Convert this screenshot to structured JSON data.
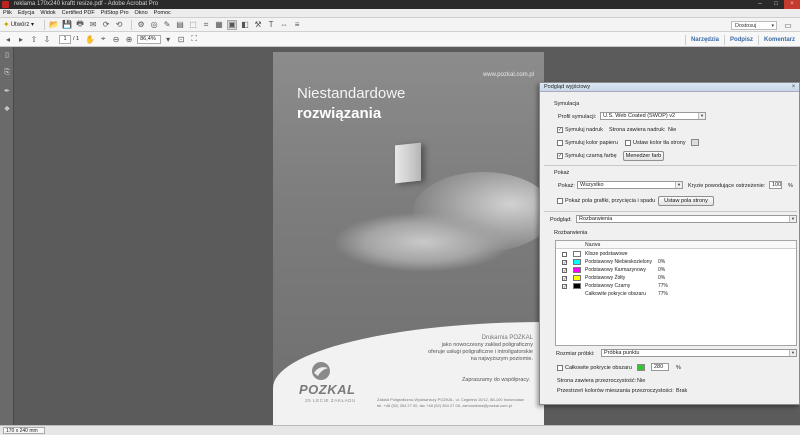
{
  "window": {
    "title": "reklama 170x240 kraftt resize.pdf - Adobe Acrobat Pro",
    "controls": [
      "–",
      "□",
      "×"
    ]
  },
  "menu": {
    "items": [
      "Plik",
      "Edycja",
      "Widok",
      "Certified PDF",
      "PitStop Pro",
      "Okno",
      "Pomoc"
    ]
  },
  "toolbar": {
    "create_label": "Utwórz",
    "workspace": "Dostosuj"
  },
  "navigation": {
    "page_current": "1",
    "page_total": "/ 1",
    "zoom": "86,4%",
    "links": [
      "Narzędzia",
      "Podpisz",
      "Komentarz"
    ]
  },
  "document": {
    "url": "www.pozkal.com.pl",
    "headline_1": "Niestandardowe",
    "headline_2": "rozwiązania",
    "drukarnia": "Drukarnia POZKAL",
    "body_lines": [
      "jako nowoczesny zakład poligraficzny",
      "oferuje usługi poligraficzne i introligatorskie",
      "na najwyższym poziomie."
    ],
    "zapraszamy": "Zapraszamy do współpracy.",
    "logo_word": "POZKAL",
    "logo_sub": "25 LECIE ZAKŁADU",
    "footer_lines": [
      "Zakład Poligraficzno-Wydawniczy POZKAL, ul. Cegielna 10/12, 88-100 Inowrocław",
      "tel. +48 (52) 354 27 00, fax +48 (52) 354 27 05, zamowienia@pozkal.com.pl"
    ]
  },
  "status": {
    "size": "170 x 240 mm"
  },
  "dialog": {
    "title": "Podgląd wyjściowy",
    "close": "×",
    "symulacja": {
      "section": "Symulacja",
      "profile_label": "Profil symulacji:",
      "profile_value": "U.S. Web Coated (SWOP) v2",
      "simulate_overprint": "Symuluj nadruk",
      "page_has_overprint": "Strona zawiera nadruk:",
      "page_has_overprint_value": "Nie",
      "simulate_paper_color": "Symuluj kolor papieru",
      "set_page_bg": "Ustaw kolor tła strony",
      "simulate_black_ink": "Symuluj czarną farbę",
      "ink_manager": "Menedżer farb"
    },
    "pokaz": {
      "section": "Pokaż",
      "show_label": "Pokaż:",
      "show_value": "Wszystko",
      "warning_label": "Kryzie powodujące ostrzeżenie:",
      "warning_value": "100",
      "warning_unit": "%",
      "show_boxes": "Pokaż pola grafiki, przycięcia i spadu",
      "set_page_boxes": "Ustaw pola strony"
    },
    "podglad": {
      "label": "Podgląd:",
      "value": "Rozbarwienia"
    },
    "rozbarwienia": {
      "section": "Rozbarwienia",
      "column_name": "Nazwa",
      "rows": [
        {
          "name": "Klisze podstawowe",
          "pct": "",
          "color": "#ffffff",
          "checked": false
        },
        {
          "name": "Podstawowy Niebieskozielony",
          "pct": "0%",
          "color": "#00ffff",
          "checked": true
        },
        {
          "name": "Podstawowy Karmazynowy",
          "pct": "0%",
          "color": "#ff00ff",
          "checked": true
        },
        {
          "name": "Podstawowy Żółty",
          "pct": "0%",
          "color": "#ffff00",
          "checked": true
        },
        {
          "name": "Podstawowy Czarny",
          "pct": "77%",
          "color": "#000000",
          "checked": true
        },
        {
          "name": "Całkowite pokrycie obszaru",
          "pct": "77%",
          "color": "",
          "checked": false
        }
      ]
    },
    "probka": {
      "label": "Rozmiar próbki:",
      "value": "Próbka punktu"
    },
    "pokrycie": {
      "label": "Całkowite pokrycie obszaru",
      "value": "280",
      "unit": "%",
      "swatch_color": "#35c435"
    },
    "transparency": {
      "label": "Strona zawiera przezroczystość:",
      "value": "Nie"
    },
    "blend": {
      "label": "Przestrzeń kolorów mieszania przezroczystości:",
      "value": "Brak"
    }
  }
}
